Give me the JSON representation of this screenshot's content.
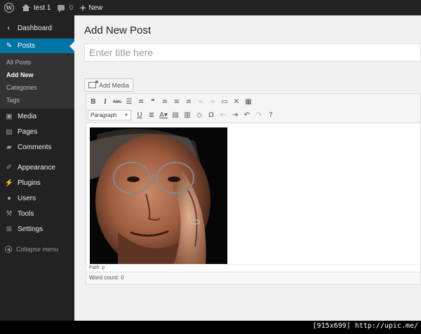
{
  "adminbar": {
    "site_name": "test 1",
    "comments_count": "0",
    "new_label": "New"
  },
  "sidebar": {
    "items": [
      {
        "label": "Dashboard",
        "icon": "dashboard-icon"
      },
      {
        "label": "Posts",
        "icon": "pin-icon",
        "active": true
      },
      {
        "label": "Media",
        "icon": "media-icon"
      },
      {
        "label": "Pages",
        "icon": "pages-icon"
      },
      {
        "label": "Comments",
        "icon": "comments-icon"
      },
      {
        "label": "Appearance",
        "icon": "brush-icon"
      },
      {
        "label": "Plugins",
        "icon": "plug-icon"
      },
      {
        "label": "Users",
        "icon": "user-icon"
      },
      {
        "label": "Tools",
        "icon": "wrench-icon"
      },
      {
        "label": "Settings",
        "icon": "settings-icon"
      }
    ],
    "posts_submenu": [
      "All Posts",
      "Add New",
      "Categories",
      "Tags"
    ],
    "current_submenu": "Add New",
    "collapse_label": "Collapse menu"
  },
  "main": {
    "page_title": "Add New Post",
    "title_placeholder": "Enter title here",
    "add_media_label": "Add Media",
    "format_select": "Paragraph",
    "path_text": "Path: p",
    "word_count_text": "Word count: 0"
  },
  "watermark": "[915x699] http://upic.me/",
  "colors": {
    "adminbar_bg": "#222222",
    "sidebar_active": "#0074a2",
    "content_bg": "#f1f1f1"
  }
}
